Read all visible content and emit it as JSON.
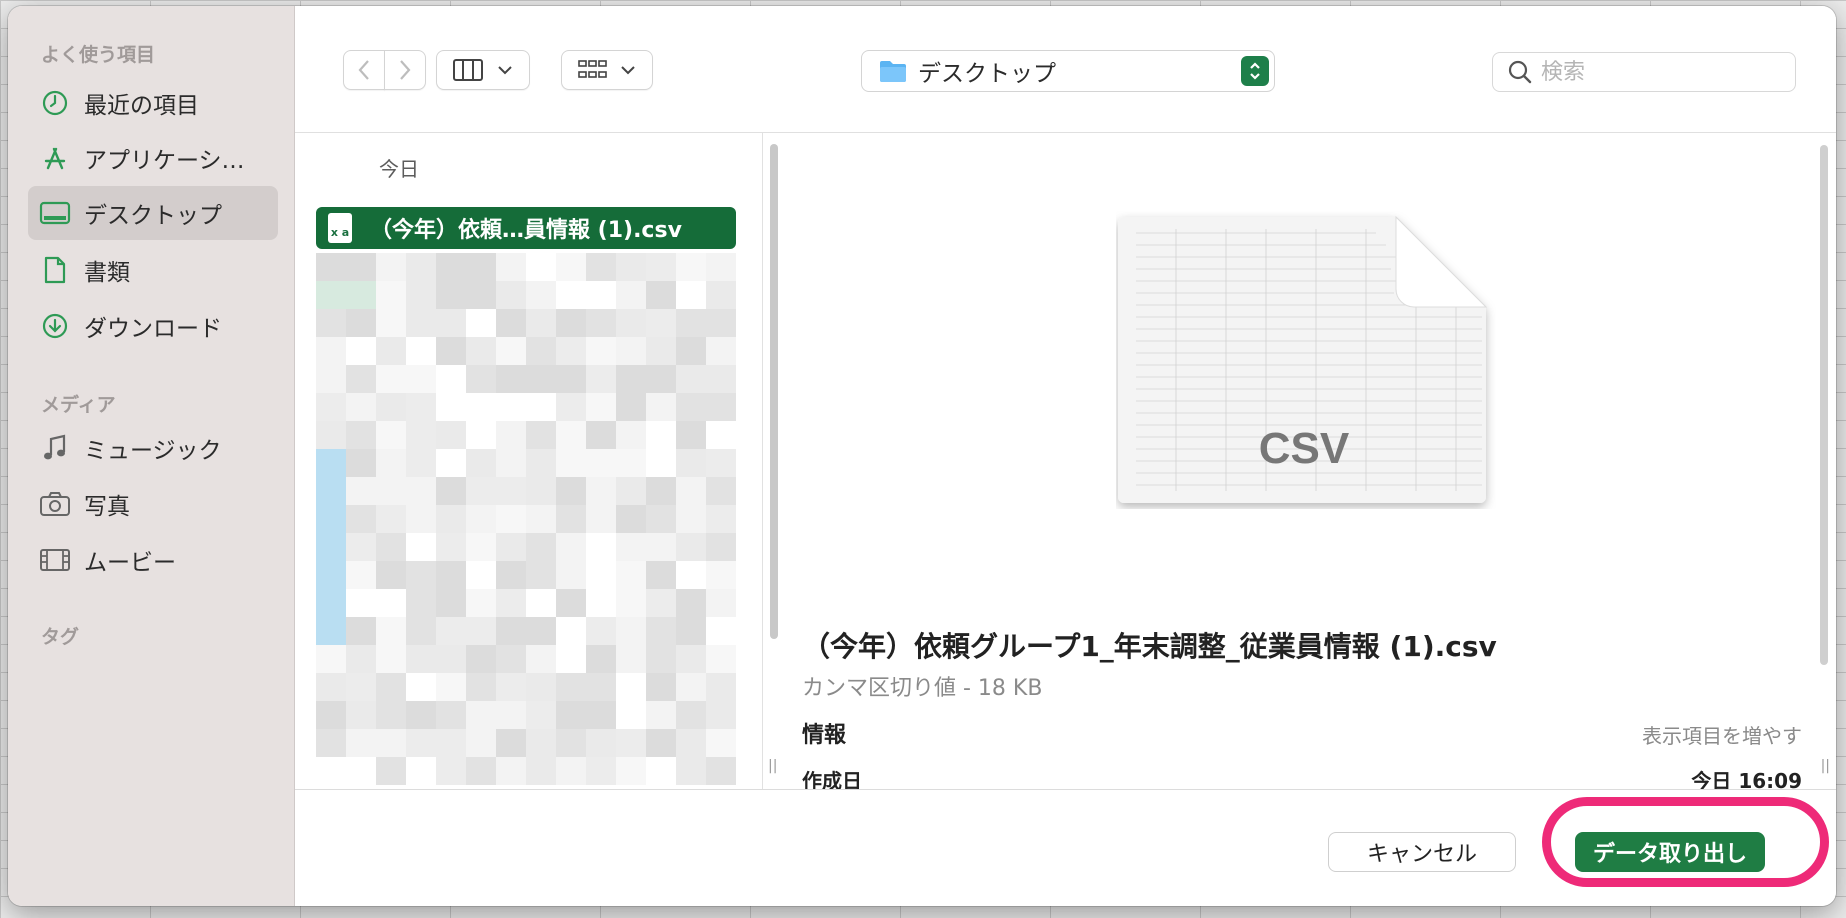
{
  "sidebar": {
    "favorites_title": "よく使う項目",
    "items": [
      {
        "label": "最近の項目",
        "icon": "clock-icon"
      },
      {
        "label": "アプリケーシ…",
        "icon": "applications-icon"
      },
      {
        "label": "デスクトップ",
        "icon": "desktop-icon"
      },
      {
        "label": "書類",
        "icon": "document-icon"
      },
      {
        "label": "ダウンロード",
        "icon": "download-icon"
      }
    ],
    "media_title": "メディア",
    "media_items": [
      {
        "label": "ミュージック",
        "icon": "music-icon"
      },
      {
        "label": "写真",
        "icon": "camera-icon"
      },
      {
        "label": "ムービー",
        "icon": "film-icon"
      }
    ],
    "tags_title": "タグ"
  },
  "toolbar": {
    "location": "デスクトップ",
    "search_placeholder": "検索"
  },
  "column": {
    "header": "今日",
    "selected_file": "（今年）依頼…員情報 (1).csv",
    "file_icon_text": "x a"
  },
  "preview": {
    "thumb_label": "CSV",
    "file_name": "（今年）依頼グループ1_年末調整_従業員情報 (1).csv",
    "kind_size": "カンマ区切り値 - 18 KB",
    "info_title": "情報",
    "show_more": "表示項目を増やす",
    "created_label": "作成日",
    "created_value": "今日 16:09"
  },
  "footer": {
    "cancel_label": "キャンセル",
    "primary_label": "データ取り出し"
  },
  "colors": {
    "accent": "#1f7d44",
    "selection": "#156c39",
    "highlight": "#ee2a78",
    "sidebar_bg": "#e7e1e0"
  }
}
